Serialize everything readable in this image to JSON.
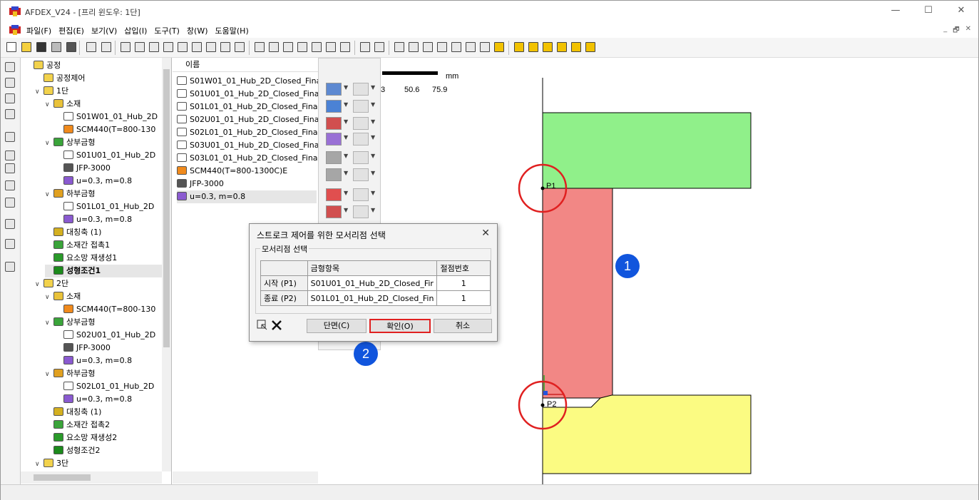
{
  "window": {
    "title": "AFDEX_V24 - [프리 윈도우: 1단]",
    "minimize_glyph": "—",
    "maximize_glyph": "☐",
    "close_glyph": "✕"
  },
  "menu": {
    "items": [
      "파일(F)",
      "편집(E)",
      "보기(V)",
      "삽입(I)",
      "도구(T)",
      "창(W)",
      "도움말(H)"
    ],
    "mdi_buttons": [
      "_",
      "🗗",
      "✕"
    ]
  },
  "tree": {
    "rows": [
      {
        "label": "공정",
        "depth": 0,
        "chev": "",
        "icon": "folder-icon"
      },
      {
        "label": "공정제어",
        "depth": 1,
        "chev": "",
        "icon": "folder-icon"
      },
      {
        "label": "1단",
        "depth": 1,
        "chev": "∨",
        "icon": "folder-icon"
      },
      {
        "label": "소재",
        "depth": 2,
        "chev": "∨",
        "icon": "material-icon"
      },
      {
        "label": "S01W01_01_Hub_2D",
        "depth": 3,
        "chev": "",
        "icon": "part-icon"
      },
      {
        "label": "SCM440(T=800-130",
        "depth": 3,
        "chev": "",
        "icon": "steel-icon"
      },
      {
        "label": "상부금형",
        "depth": 2,
        "chev": "∨",
        "icon": "upper-die-icon"
      },
      {
        "label": "S01U01_01_Hub_2D",
        "depth": 3,
        "chev": "",
        "icon": "die-part-icon"
      },
      {
        "label": "JFP-3000",
        "depth": 3,
        "chev": "",
        "icon": "press-icon"
      },
      {
        "label": "u=0.3, m=0.8",
        "depth": 3,
        "chev": "",
        "icon": "friction-icon"
      },
      {
        "label": "하부금형",
        "depth": 2,
        "chev": "∨",
        "icon": "lower-die-icon"
      },
      {
        "label": "S01L01_01_Hub_2D",
        "depth": 3,
        "chev": "",
        "icon": "die-part-icon"
      },
      {
        "label": "u=0.3, m=0.8",
        "depth": 3,
        "chev": "",
        "icon": "friction-icon"
      },
      {
        "label": "대칭축 (1)",
        "depth": 2,
        "chev": "",
        "icon": "symmetry-icon"
      },
      {
        "label": "소재간 접촉1",
        "depth": 2,
        "chev": "",
        "icon": "contact-icon"
      },
      {
        "label": "요소망 재생성1",
        "depth": 2,
        "chev": "",
        "icon": "remesh-icon"
      },
      {
        "label": "성형조건1",
        "depth": 2,
        "chev": "",
        "icon": "condition-icon",
        "selected": true
      },
      {
        "label": "2단",
        "depth": 1,
        "chev": "∨",
        "icon": "folder-icon"
      },
      {
        "label": "소재",
        "depth": 2,
        "chev": "∨",
        "icon": "material-icon"
      },
      {
        "label": "SCM440(T=800-130",
        "depth": 3,
        "chev": "",
        "icon": "steel-icon"
      },
      {
        "label": "상부금형",
        "depth": 2,
        "chev": "∨",
        "icon": "upper-die-icon"
      },
      {
        "label": "S02U01_01_Hub_2D",
        "depth": 3,
        "chev": "",
        "icon": "die-part-icon"
      },
      {
        "label": "JFP-3000",
        "depth": 3,
        "chev": "",
        "icon": "press-icon"
      },
      {
        "label": "u=0.3, m=0.8",
        "depth": 3,
        "chev": "",
        "icon": "friction-icon"
      },
      {
        "label": "하부금형",
        "depth": 2,
        "chev": "∨",
        "icon": "lower-die-icon"
      },
      {
        "label": "S02L01_01_Hub_2D",
        "depth": 3,
        "chev": "",
        "icon": "die-part-icon"
      },
      {
        "label": "u=0.3, m=0.8",
        "depth": 3,
        "chev": "",
        "icon": "friction-icon"
      },
      {
        "label": "대칭축 (1)",
        "depth": 2,
        "chev": "",
        "icon": "symmetry-icon"
      },
      {
        "label": "소재간 접촉2",
        "depth": 2,
        "chev": "",
        "icon": "contact-icon"
      },
      {
        "label": "요소망 재생성2",
        "depth": 2,
        "chev": "",
        "icon": "remesh-icon"
      },
      {
        "label": "성형조건2",
        "depth": 2,
        "chev": "",
        "icon": "condition-icon"
      },
      {
        "label": "3단",
        "depth": 1,
        "chev": "∨",
        "icon": "folder-icon"
      }
    ]
  },
  "list": {
    "header": "이름",
    "rows": [
      {
        "label": "S01W01_01_Hub_2D_Closed_Fina",
        "icon": "part-icon"
      },
      {
        "label": "S01U01_01_Hub_2D_Closed_Final",
        "icon": "part-icon"
      },
      {
        "label": "S01L01_01_Hub_2D_Closed_Final",
        "icon": "part-icon"
      },
      {
        "label": "S02U01_01_Hub_2D_Closed_Final",
        "icon": "part-icon"
      },
      {
        "label": "S02L01_01_Hub_2D_Closed_Final",
        "icon": "part-icon"
      },
      {
        "label": "S03U01_01_Hub_2D_Closed_Final",
        "icon": "part-icon"
      },
      {
        "label": "S03L01_01_Hub_2D_Closed_Final",
        "icon": "part-icon"
      },
      {
        "label": "SCM440(T=800-1300C)E",
        "icon": "steel-icon"
      },
      {
        "label": "JFP-3000",
        "icon": "press-icon"
      },
      {
        "label": "u=0.3, m=0.8",
        "icon": "friction-icon",
        "selected": true
      }
    ]
  },
  "canvas": {
    "scale_unit": "mm",
    "scale_ticks": [
      "3",
      "50.6",
      "75.9"
    ],
    "point1_label": "P1",
    "point2_label": "P2"
  },
  "dialog": {
    "title": "스트로크 제어를 위한 모서리점 선택",
    "close_glyph": "✕",
    "group_label": "모서리점 선택",
    "col_headers": [
      "금형항목",
      "절점번호"
    ],
    "rows": [
      {
        "label": "시작 (P1)",
        "item": "S01U01_01_Hub_2D_Closed_Fir",
        "node": "1"
      },
      {
        "label": "종료 (P2)",
        "item": "S01L01_01_Hub_2D_Closed_Fin",
        "node": "1"
      }
    ],
    "btn_section": "단면(C)",
    "btn_ok": "확인(O)",
    "btn_cancel": "취소"
  },
  "annotations": {
    "badge1": "1",
    "badge2": "2"
  },
  "colors": {
    "upper_die": "#90f08a",
    "workpiece": "#f28785",
    "lower_die": "#fbfb82",
    "highlight": "#e02020",
    "badge": "#1155dd"
  }
}
